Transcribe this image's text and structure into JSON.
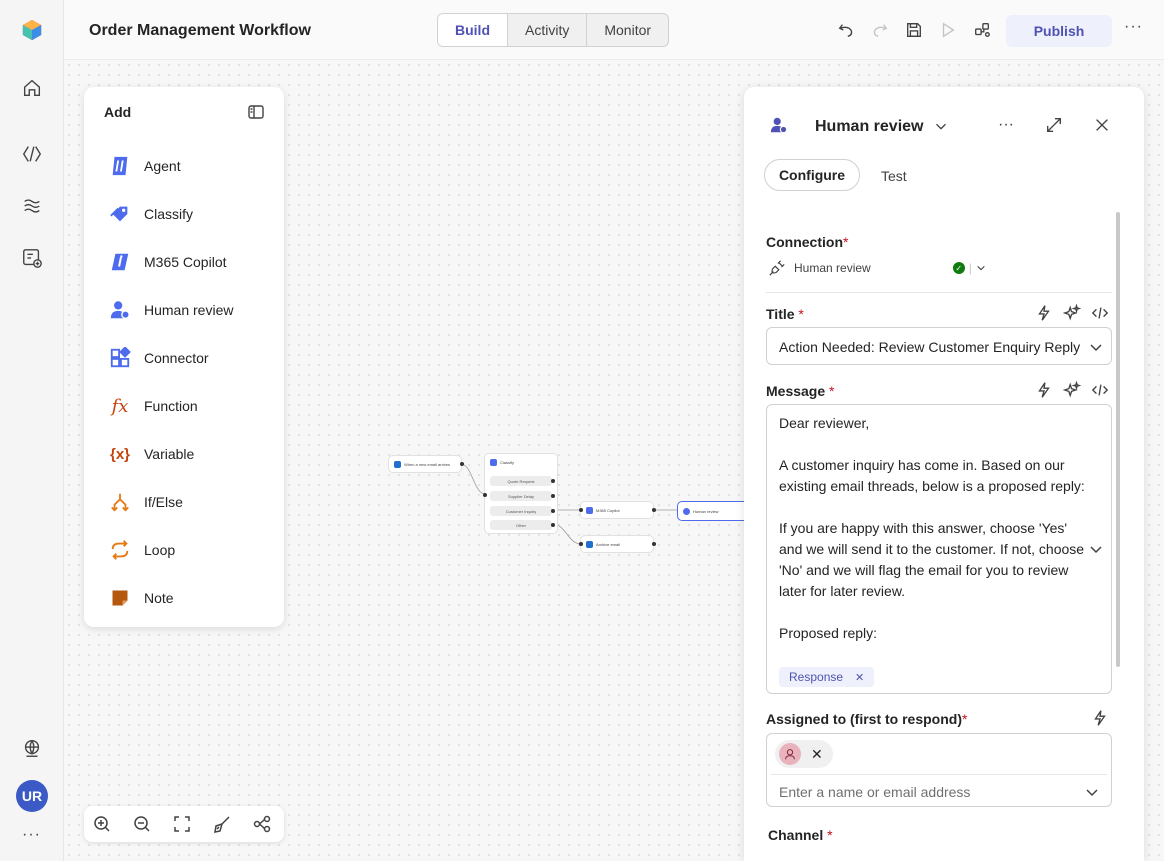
{
  "app": {
    "title": "Order Management Workflow",
    "tabs": [
      "Build",
      "Activity",
      "Monitor"
    ],
    "active_tab": "Build",
    "publish_label": "Publish",
    "user_initials": "UR",
    "accent_color": "#4f52b2"
  },
  "rail": {
    "icons": [
      "home-icon",
      "agents-icon",
      "knowledge-icon",
      "add-app-icon",
      "globe-icon"
    ]
  },
  "add_panel": {
    "title": "Add",
    "items": [
      {
        "label": "Agent",
        "icon": "agent-icon"
      },
      {
        "label": "Classify",
        "icon": "tag-icon"
      },
      {
        "label": "M365 Copilot",
        "icon": "copilot-icon"
      },
      {
        "label": "Human review",
        "icon": "person-icon"
      },
      {
        "label": "Connector",
        "icon": "connector-icon"
      },
      {
        "label": "Function",
        "icon": "function-icon"
      },
      {
        "label": "Variable",
        "icon": "variable-icon"
      },
      {
        "label": "If/Else",
        "icon": "branch-icon"
      },
      {
        "label": "Loop",
        "icon": "loop-icon"
      },
      {
        "label": "Note",
        "icon": "note-icon"
      }
    ]
  },
  "flow": {
    "trigger": "When a new email arrives",
    "classify": "Classify",
    "classify_options": [
      "Quote Request",
      "Supplier Delay",
      "Customer Inquiry",
      "Other"
    ],
    "m365": "M365 Copilot",
    "human": "Human review",
    "archive": "Archive email"
  },
  "detail": {
    "title": "Human review",
    "tabs": [
      "Configure",
      "Test"
    ],
    "connection_label": "Connection",
    "connection_value": "Human review",
    "title_label": "Title",
    "title_value": "Action Needed: Review Customer Enquiry Reply",
    "message_label": "Message",
    "message_lines": [
      "Dear reviewer,",
      "",
      "A customer inquiry has come in. Based on our existing email threads, below is a proposed reply:",
      "",
      "If you are happy with this answer, choose 'Yes' and we will send it to the customer. If not, choose 'No' and we will flag the email for you to review later for later review.",
      "",
      "Proposed reply:"
    ],
    "response_chip": "Response",
    "assigned_label": "Assigned to (first to respond)",
    "assignee_placeholder": "Enter a name or email address",
    "channel_label": "Channel",
    "required_mark": "*"
  }
}
